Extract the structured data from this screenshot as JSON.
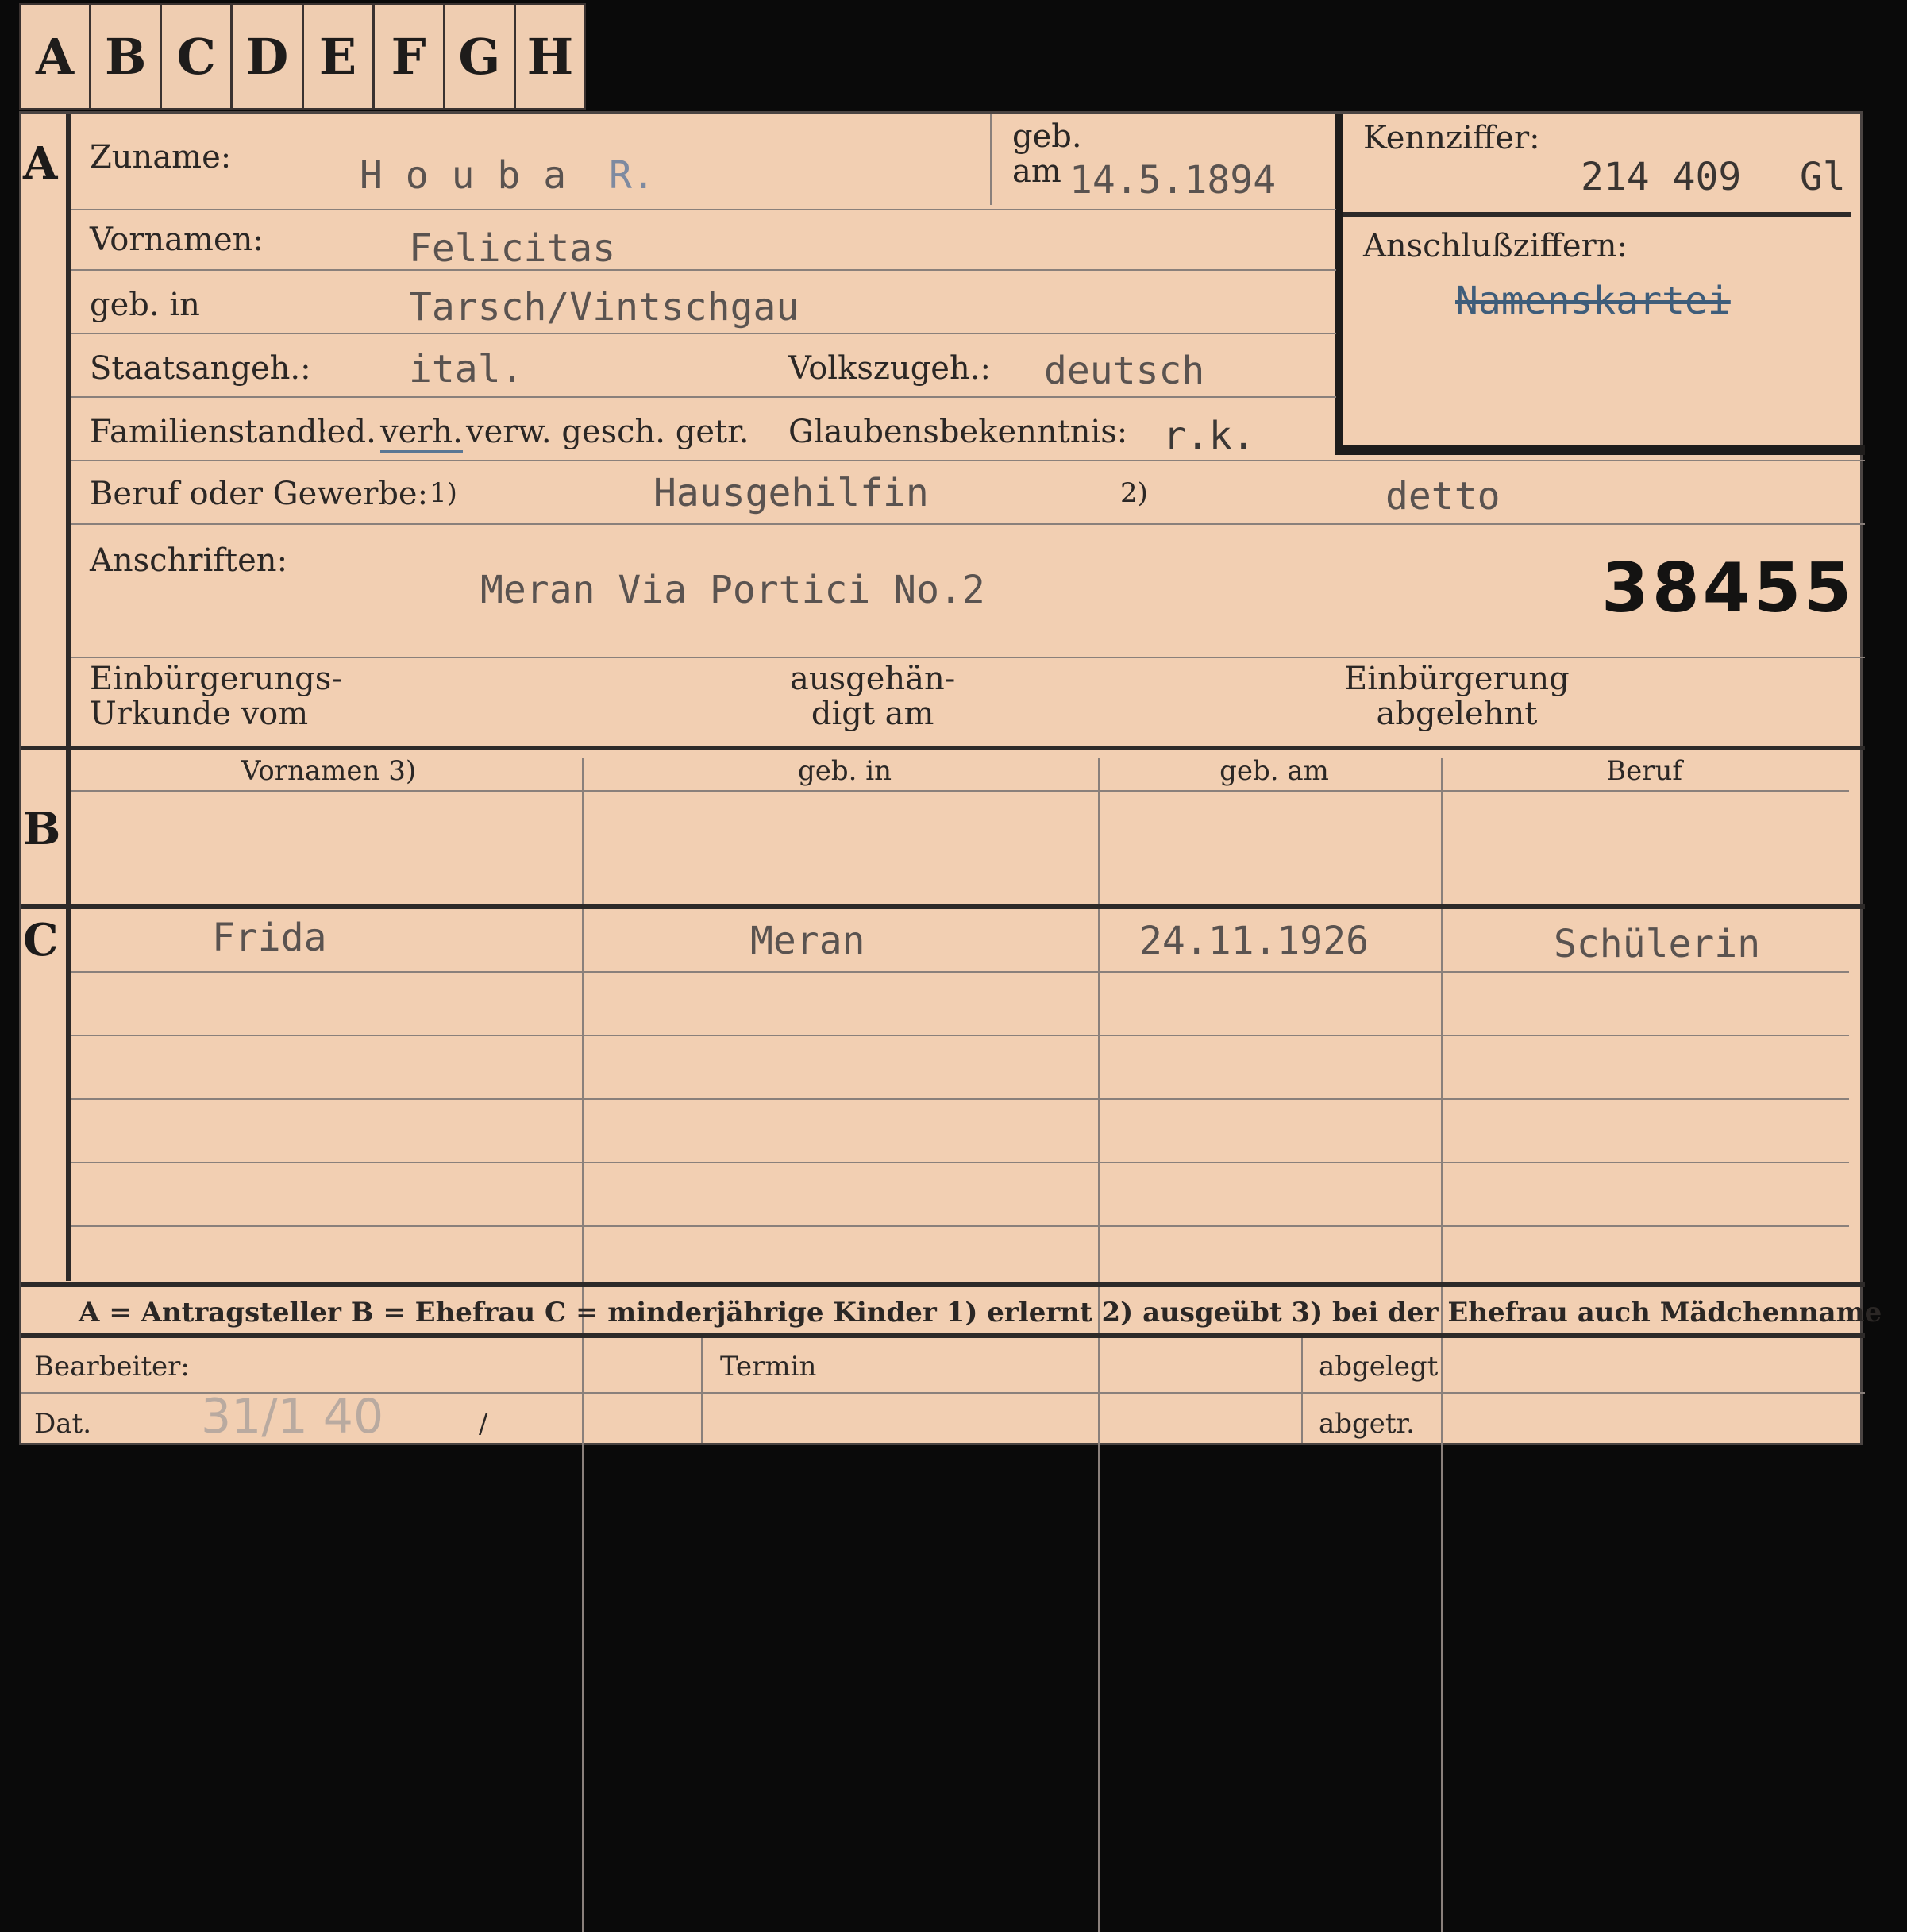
{
  "tabs": [
    "A",
    "B",
    "C",
    "D",
    "E",
    "F",
    "G",
    "H"
  ],
  "sections": {
    "a": "A",
    "b": "B",
    "c": "C"
  },
  "fields": {
    "zuname_label": "Zuname:",
    "zuname_value": "H o u b a",
    "zuname_mark": "R.",
    "geb_label": "geb.",
    "am_label": "am",
    "geb_am_value": "14.5.1894",
    "kennziffer_label": "Kennziffer:",
    "kennziffer_value": "214 409",
    "kennziffer_suffix": "Gl",
    "anschluss_label": "Anschlußziffern:",
    "anschluss_value": "Namenskartei",
    "vornamen_label": "Vornamen:",
    "vornamen_value": "Felicitas",
    "gebin_label": "geb. in",
    "gebin_value": "Tarsch/Vintschgau",
    "staats_label": "Staatsangeh.:",
    "staats_value": "ital.",
    "volks_label": "Volkszugeh.:",
    "volks_value": "deutsch",
    "familien_label": "Familienstand:",
    "familien_led": "led.",
    "familien_verh": "verh.",
    "familien_rest": "verw. gesch. getr.",
    "glaubens_label": "Glaubensbekenntnis:",
    "glaubens_value": "r.k.",
    "beruf_label": "Beruf oder Gewerbe:",
    "note1": "1)",
    "beruf_value": "Hausgehilfin",
    "note2": "2)",
    "beruf_value2": "detto",
    "anschriften_label": "Anschriften:",
    "anschriften_value": "Meran Via Portici No.2",
    "stamp_number": "38455",
    "einb_label_1": "Einbürgerungs-",
    "einb_label_2": "Urkunde vom",
    "ausg_label_1": "ausgehän-",
    "ausg_label_2": "digt am",
    "einb_abg_1": "Einbürgerung",
    "einb_abg_2": "abgelehnt"
  },
  "table_headers": [
    "Vornamen 3)",
    "geb. in",
    "geb. am",
    "Beruf"
  ],
  "children": [
    {
      "vorname": "Frida",
      "geb_in": "Meran",
      "geb_am": "24.11.1926",
      "beruf": "Schülerin"
    }
  ],
  "legend": "A = Antragsteller   B = Ehefrau   C = minderjährige Kinder   1) erlernt   2) ausgeübt   3) bei der Ehefrau auch Mädchenname",
  "footer": {
    "bearbeiter_label": "Bearbeiter:",
    "dat_label": "Dat.",
    "dat_value": "31/1 40",
    "dat_slash": "/",
    "termin_label": "Termin",
    "abgelegt_label": "abgelegt",
    "abgetr_label": "abgetr."
  }
}
